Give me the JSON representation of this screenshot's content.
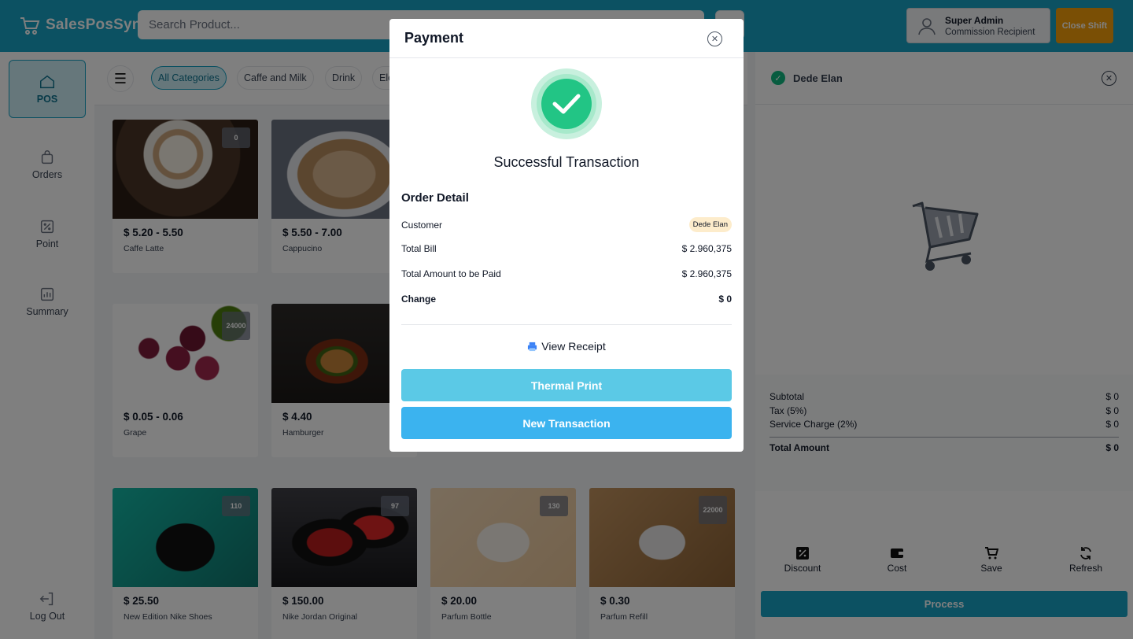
{
  "app": {
    "name": "SalesPosSync"
  },
  "header": {
    "search_placeholder": "Search Product...",
    "user_name": "Super Admin",
    "user_role": "Commission Recipient",
    "close_shift": "Close Shift"
  },
  "nav": {
    "items": [
      {
        "label": "POS",
        "icon": "home-icon",
        "active": true
      },
      {
        "label": "Orders",
        "icon": "shopping-bag-icon"
      },
      {
        "label": "Point",
        "icon": "discount-icon"
      },
      {
        "label": "Summary",
        "icon": "chart-icon"
      },
      {
        "label": "Log Out",
        "icon": "logout-icon"
      }
    ]
  },
  "categories": [
    "All Categories",
    "Caffe and Milk",
    "Drink",
    "Ele"
  ],
  "products": [
    {
      "price": "$ 5.20 - 5.50",
      "name": "Caffe Latte",
      "stock": [
        "0"
      ]
    },
    {
      "price": "$ 5.50 - 7.00",
      "name": "Cappucino",
      "stock": []
    },
    {
      "price": "$ 0.05 - 0.06",
      "name": "Grape",
      "stock": [
        "2400",
        "0"
      ]
    },
    {
      "price": "$ 4.40",
      "name": "Hamburger",
      "stock": []
    },
    {
      "price": "$ 25.50",
      "name": "New Edition Nike Shoes",
      "stock": [
        "110"
      ]
    },
    {
      "price": "$ 150.00",
      "name": "Nike Jordan Original",
      "stock": [
        "97"
      ]
    },
    {
      "price": "$ 20.00",
      "name": "Parfum Bottle",
      "stock": [
        "130"
      ]
    },
    {
      "price": "$ 0.30",
      "name": "Parfum Refill",
      "stock": [
        "2200",
        "0"
      ]
    }
  ],
  "cart": {
    "customer": "Dede Elan",
    "subtotal_label": "Subtotal",
    "subtotal": "$ 0",
    "tax_label": "Tax (5%)",
    "tax": "$ 0",
    "service_label": "Service Charge (2%)",
    "service": "$ 0",
    "total_label": "Total Amount",
    "total": "$ 0",
    "actions": [
      "Discount",
      "Cost",
      "Save",
      "Refresh"
    ],
    "process": "Process"
  },
  "modal": {
    "title": "Payment",
    "status": "Successful Transaction",
    "order_detail_title": "Order Detail",
    "customer_label": "Customer",
    "customer_value": "Dede Elan",
    "total_bill_label": "Total Bill",
    "total_bill_value": "$ 2.960,375",
    "to_pay_label": "Total Amount to be Paid",
    "to_pay_value": "$ 2.960,375",
    "change_label": "Change",
    "change_value": "$ 0",
    "view_receipt": "View Receipt",
    "thermal_print": "Thermal Print",
    "new_transaction": "New Transaction"
  },
  "colors": {
    "primary": "#19a3c4",
    "success": "#22c585",
    "warning": "#f59e0b",
    "button_blue": "#3bb3ef"
  }
}
